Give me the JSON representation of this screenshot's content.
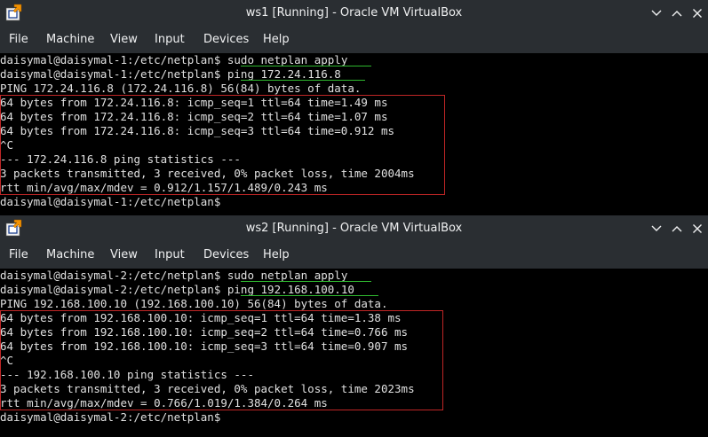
{
  "windows": [
    {
      "title": "ws1 [Running] - Oracle VM VirtualBox",
      "menu": [
        "File",
        "Machine",
        "View",
        "Input",
        "Devices",
        "Help"
      ],
      "terminal": {
        "prompt": "daisymal@daisymal-1:/etc/netplan$",
        "lines": [
          {
            "prompt": "daisymal@daisymal-1:/etc/netplan$",
            "cmd": " sudo netplan apply"
          },
          {
            "prompt": "daisymal@daisymal-1:/etc/netplan$",
            "cmd": " ping 172.24.116.8"
          },
          {
            "text": "PING 172.24.116.8 (172.24.116.8) 56(84) bytes of data."
          },
          {
            "text": "64 bytes from 172.24.116.8: icmp_seq=1 ttl=64 time=1.49 ms"
          },
          {
            "text": "64 bytes from 172.24.116.8: icmp_seq=2 ttl=64 time=1.07 ms"
          },
          {
            "text": "64 bytes from 172.24.116.8: icmp_seq=3 ttl=64 time=0.912 ms"
          },
          {
            "text": "^C"
          },
          {
            "text": "--- 172.24.116.8 ping statistics ---"
          },
          {
            "text": "3 packets transmitted, 3 received, 0% packet loss, time 2004ms"
          },
          {
            "text": "rtt min/avg/max/mdev = 0.912/1.157/1.489/0.243 ms"
          },
          {
            "prompt": "daisymal@daisymal-1:/etc/netplan$",
            "cmd": ""
          }
        ]
      }
    },
    {
      "title": "ws2 [Running] - Oracle VM VirtualBox",
      "menu": [
        "File",
        "Machine",
        "View",
        "Input",
        "Devices",
        "Help"
      ],
      "terminal": {
        "prompt": "daisymal@daisymal-2:/etc/netplan$",
        "lines": [
          {
            "prompt": "daisymal@daisymal-2:/etc/netplan$",
            "cmd": " sudo netplan apply"
          },
          {
            "prompt": "daisymal@daisymal-2:/etc/netplan$",
            "cmd": " ping 192.168.100.10"
          },
          {
            "text": "PING 192.168.100.10 (192.168.100.10) 56(84) bytes of data."
          },
          {
            "text": "64 bytes from 192.168.100.10: icmp_seq=1 ttl=64 time=1.38 ms"
          },
          {
            "text": "64 bytes from 192.168.100.10: icmp_seq=2 ttl=64 time=0.766 ms"
          },
          {
            "text": "64 bytes from 192.168.100.10: icmp_seq=3 ttl=64 time=0.907 ms"
          },
          {
            "text": "^C"
          },
          {
            "text": "--- 192.168.100.10 ping statistics ---"
          },
          {
            "text": "3 packets transmitted, 3 received, 0% packet loss, time 2023ms"
          },
          {
            "text": "rtt min/avg/max/mdev = 0.766/1.019/1.384/0.264 ms"
          },
          {
            "prompt": "daisymal@daisymal-2:/etc/netplan$",
            "cmd": ""
          }
        ]
      }
    }
  ],
  "icons": {
    "app": "virtualbox-icon",
    "minimize": "chevron-down-icon",
    "maximize": "chevron-up-icon",
    "close": "close-icon"
  },
  "colors": {
    "titlebar_bg": "#2a2e32",
    "terminal_bg": "#000000",
    "terminal_fg": "#e0e0e0",
    "command_underline": "#2fb82f",
    "highlight_box": "#c02626"
  }
}
